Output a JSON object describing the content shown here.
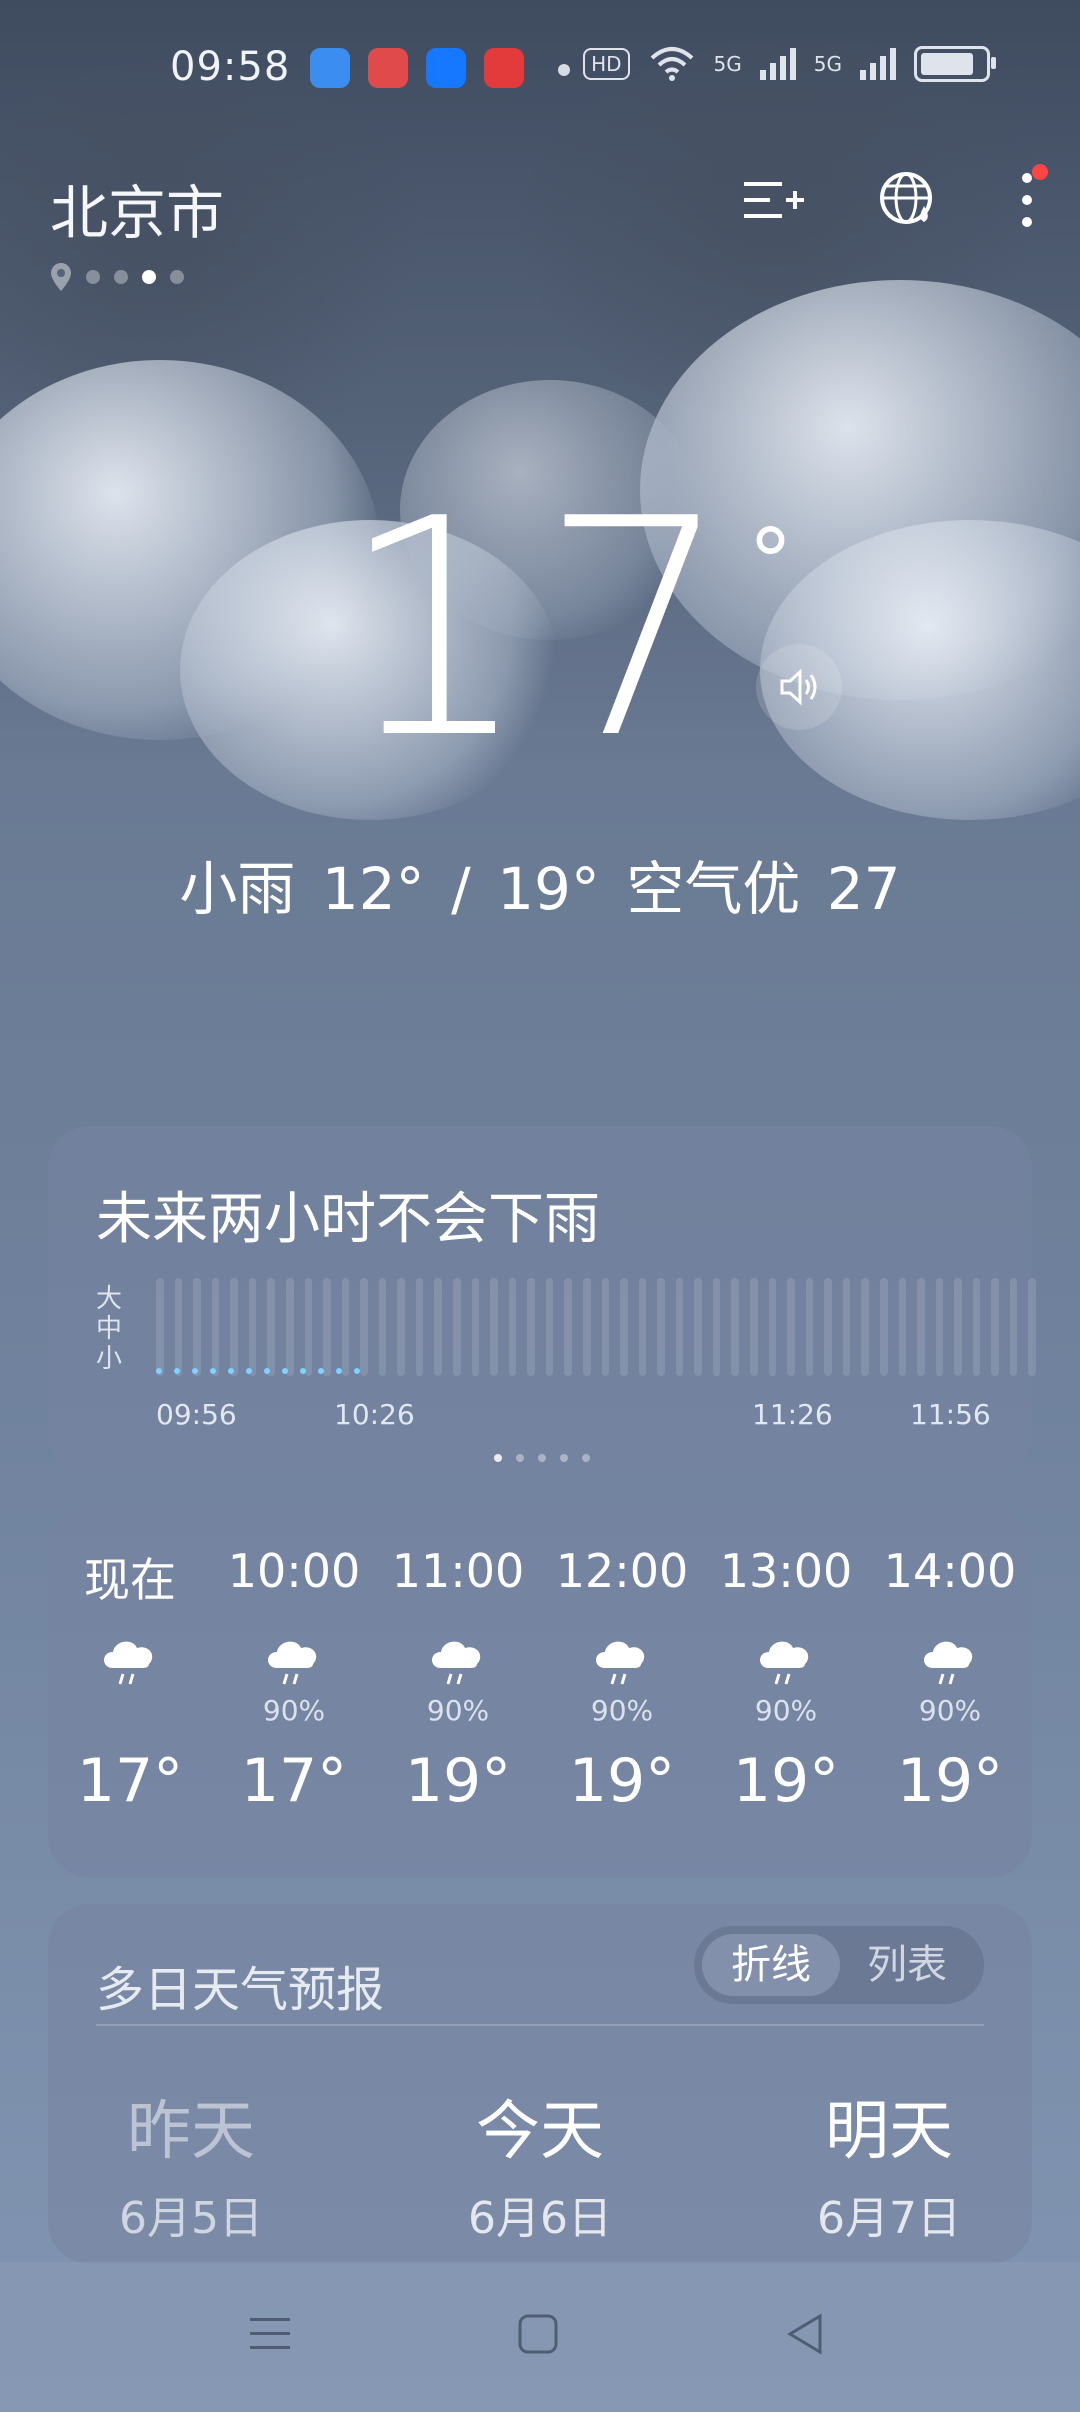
{
  "status": {
    "time": "09:58",
    "hd_label": "HD",
    "signal1": "5G",
    "signal2": "5G"
  },
  "header": {
    "city": "北京市"
  },
  "current": {
    "temperature": "17",
    "degree": "°",
    "summary": "小雨  12° / 19°  空气优 27"
  },
  "rain_card": {
    "title": "未来两小时不会下雨",
    "scale": [
      "大",
      "中",
      "小"
    ],
    "times": [
      "09:56",
      "10:26",
      "11:26",
      "11:56"
    ]
  },
  "hourly": [
    {
      "time": "现在",
      "prob": "",
      "temp": "17°"
    },
    {
      "time": "10:00",
      "prob": "90%",
      "temp": "17°"
    },
    {
      "time": "11:00",
      "prob": "90%",
      "temp": "19°"
    },
    {
      "time": "12:00",
      "prob": "90%",
      "temp": "19°"
    },
    {
      "time": "13:00",
      "prob": "90%",
      "temp": "19°"
    },
    {
      "time": "14:00",
      "prob": "90%",
      "temp": "19°"
    }
  ],
  "forecast": {
    "title": "多日天气预报",
    "toggle_active": "折线",
    "toggle_inactive": "列表",
    "days": [
      {
        "name": "昨天",
        "date": "6月5日"
      },
      {
        "name": "今天",
        "date": "6月6日"
      },
      {
        "name": "明天",
        "date": "6月7日"
      }
    ]
  },
  "colors": {
    "rain_dot": "#7fd2ff",
    "notification_dot": "#ff4444"
  },
  "icons": {
    "weather": "light-rain-cloud",
    "add_city": "add-list-icon",
    "globe": "globe-icon",
    "more": "more-vertical-icon"
  }
}
